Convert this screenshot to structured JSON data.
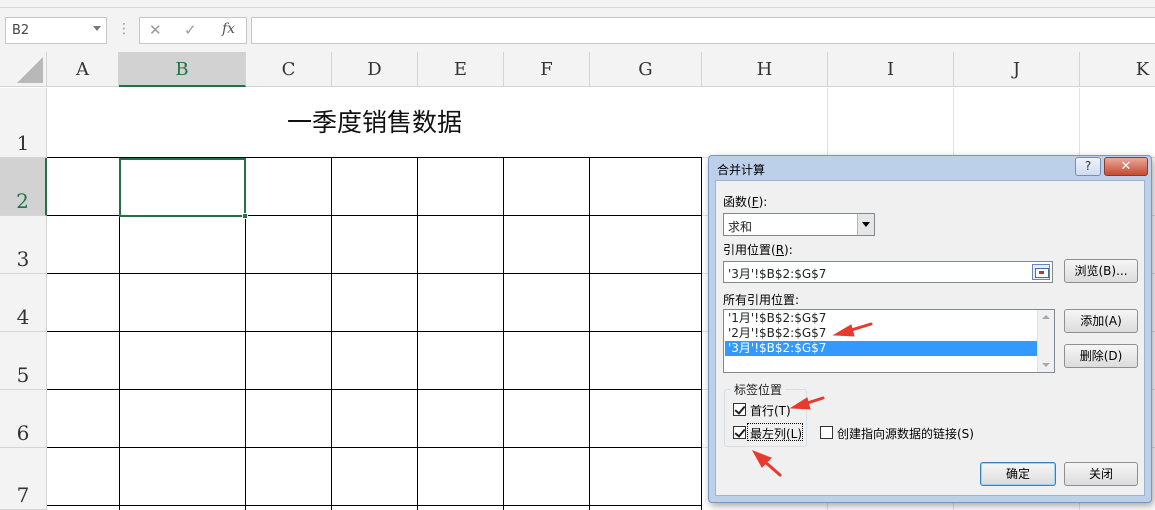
{
  "formula_bar": {
    "namebox": "B2",
    "cancel_glyph": "✕",
    "enter_glyph": "✓",
    "fx_label": "fx",
    "formula": ""
  },
  "columns": [
    "A",
    "B",
    "C",
    "D",
    "E",
    "F",
    "G",
    "H",
    "I",
    "J",
    "K"
  ],
  "rows": [
    "1",
    "2",
    "3",
    "4",
    "5",
    "6",
    "7"
  ],
  "sheet": {
    "title": "一季度销售数据",
    "active_cell": "B2"
  },
  "dialog": {
    "title": "合并计算",
    "help": "?",
    "close": "✕",
    "function_label": "函数(",
    "function_key": "F",
    "function_label_end": "):",
    "function_value": "求和",
    "reference_label": "引用位置(",
    "reference_key": "R",
    "reference_label_end": "):",
    "reference_value": "'3月'!$B$2:$G$7",
    "browse_button": "浏览(B)...",
    "all_references_label": "所有引用位置:",
    "all_references": [
      "'1月'!$B$2:$G$7",
      "'2月'!$B$2:$G$7",
      "'3月'!$B$2:$G$7"
    ],
    "selected_reference_index": 2,
    "add_button": "添加(A)",
    "delete_button": "删除(D)",
    "labels_group": "标签位置",
    "top_row_label": "首行(T)",
    "top_row_checked": true,
    "left_column_label": "最左列(L)",
    "left_column_checked": true,
    "link_label": "创建指向源数据的链接(S)",
    "link_checked": false,
    "ok_button": "确定",
    "close_button": "关闭"
  },
  "colors": {
    "selection_green": "#217346",
    "annotation_red": "#e8392f",
    "list_highlight": "#3399ff"
  }
}
